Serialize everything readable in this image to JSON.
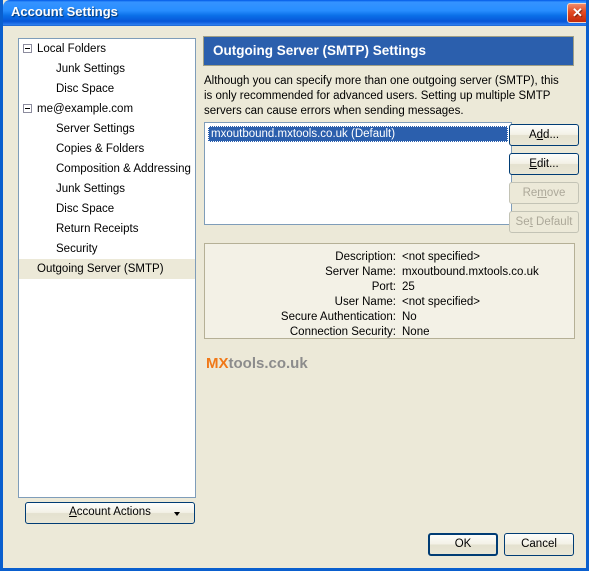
{
  "window": {
    "title": "Account Settings",
    "close_icon": "close-icon",
    "close_glyph": "✕"
  },
  "sidebar": {
    "items": [
      {
        "label": "Local Folders",
        "level": "root",
        "expander": "minus-box-icon",
        "selected": false
      },
      {
        "label": "Junk Settings",
        "level": "child",
        "selected": false
      },
      {
        "label": "Disc Space",
        "level": "child",
        "selected": false
      },
      {
        "label": "me@example.com",
        "level": "root",
        "expander": "minus-box-icon",
        "selected": false
      },
      {
        "label": "Server Settings",
        "level": "child",
        "selected": false
      },
      {
        "label": "Copies & Folders",
        "level": "child",
        "selected": false
      },
      {
        "label": "Composition & Addressing",
        "level": "child",
        "selected": false
      },
      {
        "label": "Junk Settings",
        "level": "child",
        "selected": false
      },
      {
        "label": "Disc Space",
        "level": "child",
        "selected": false
      },
      {
        "label": "Return Receipts",
        "level": "child",
        "selected": false
      },
      {
        "label": "Security",
        "level": "child",
        "selected": false
      },
      {
        "label": "Outgoing Server (SMTP)",
        "level": "root-plain",
        "selected": true
      }
    ],
    "account_actions": {
      "label_prefix": "",
      "mnemonic": "A",
      "label_rest": "ccount Actions",
      "dropdown_icon": "chevron-down-icon"
    }
  },
  "main": {
    "header_title": "Outgoing Server (SMTP) Settings",
    "description": "Although you can specify more than one outgoing server (SMTP), this is only recommended for advanced users. Setting up multiple SMTP servers can cause errors when sending messages.",
    "server_list": {
      "items": [
        {
          "label": "mxoutbound.mxtools.co.uk (Default)",
          "selected": true
        }
      ]
    },
    "buttons": {
      "add": {
        "prefix": "A",
        "mnemonic": "d",
        "rest": "d...",
        "enabled": true
      },
      "edit": {
        "prefix": "",
        "mnemonic": "E",
        "rest": "dit...",
        "enabled": true
      },
      "remove": {
        "prefix": "Re",
        "mnemonic": "m",
        "rest": "ove",
        "enabled": false
      },
      "set_default": {
        "prefix": "Se",
        "mnemonic": "t",
        "rest": " Default",
        "enabled": false
      }
    },
    "details": [
      {
        "label": "Description:",
        "value": "<not specified>"
      },
      {
        "label": "Server Name:",
        "value": "mxoutbound.mxtools.co.uk"
      },
      {
        "label": "Port:",
        "value": "25"
      },
      {
        "label": "User Name:",
        "value": "<not specified>"
      },
      {
        "label": "Secure Authentication:",
        "value": "No"
      },
      {
        "label": "Connection Security:",
        "value": "None"
      }
    ],
    "watermark": {
      "part1": "MX",
      "part2": "tools.co.uk",
      "color1": "#f07818",
      "color2": "#8c8c8c"
    }
  },
  "footer": {
    "ok_label": "OK",
    "cancel_label": "Cancel"
  },
  "colors": {
    "titlebar_blue": "#0a5fce",
    "header_blue": "#2b5fad",
    "dialog_beige": "#ece9d8",
    "selection_blue": "#2b5fad",
    "close_red": "#c2290a"
  }
}
